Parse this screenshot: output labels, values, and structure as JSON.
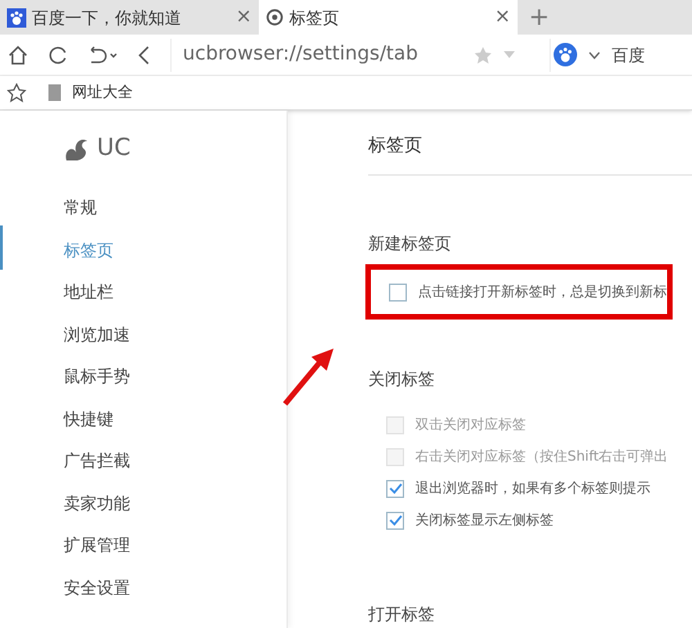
{
  "tabs": [
    {
      "title": "百度一下，你就知道",
      "selected": false,
      "close": "×"
    },
    {
      "title": "标签页",
      "selected": true,
      "close": "×"
    }
  ],
  "new_tab": "+",
  "address_bar": {
    "url": "ucbrowser://settings/tab",
    "search_engine": "百度"
  },
  "bookmarks": [
    {
      "label": "网址大全"
    }
  ],
  "sidebar": {
    "logo": "UC",
    "items": [
      {
        "label": "常规",
        "selected": false
      },
      {
        "label": "标签页",
        "selected": true
      },
      {
        "label": "地址栏",
        "selected": false
      },
      {
        "label": "浏览加速",
        "selected": false
      },
      {
        "label": "鼠标手势",
        "selected": false
      },
      {
        "label": "快捷键",
        "selected": false
      },
      {
        "label": "广告拦截",
        "selected": false
      },
      {
        "label": "卖家功能",
        "selected": false
      },
      {
        "label": "扩展管理",
        "selected": false
      },
      {
        "label": "安全设置",
        "selected": false
      }
    ]
  },
  "page_title": "标签页",
  "sections": [
    {
      "title": "新建标签页",
      "options": [
        {
          "label": "点击链接打开新标签时，总是切换到新标",
          "checked": false,
          "disabled": false,
          "highlighted": true
        }
      ]
    },
    {
      "title": "关闭标签",
      "options": [
        {
          "label": "双击关闭对应标签",
          "checked": false,
          "disabled": true,
          "highlighted": false
        },
        {
          "label": "右击关闭对应标签（按住Shift右击可弹出",
          "checked": false,
          "disabled": true,
          "highlighted": false
        },
        {
          "label": "退出浏览器时，如果有多个标签则提示",
          "checked": true,
          "disabled": false,
          "highlighted": false
        },
        {
          "label": "关闭标签显示左侧标签",
          "checked": true,
          "disabled": false,
          "highlighted": false
        }
      ]
    },
    {
      "title": "打开标签"
    }
  ]
}
